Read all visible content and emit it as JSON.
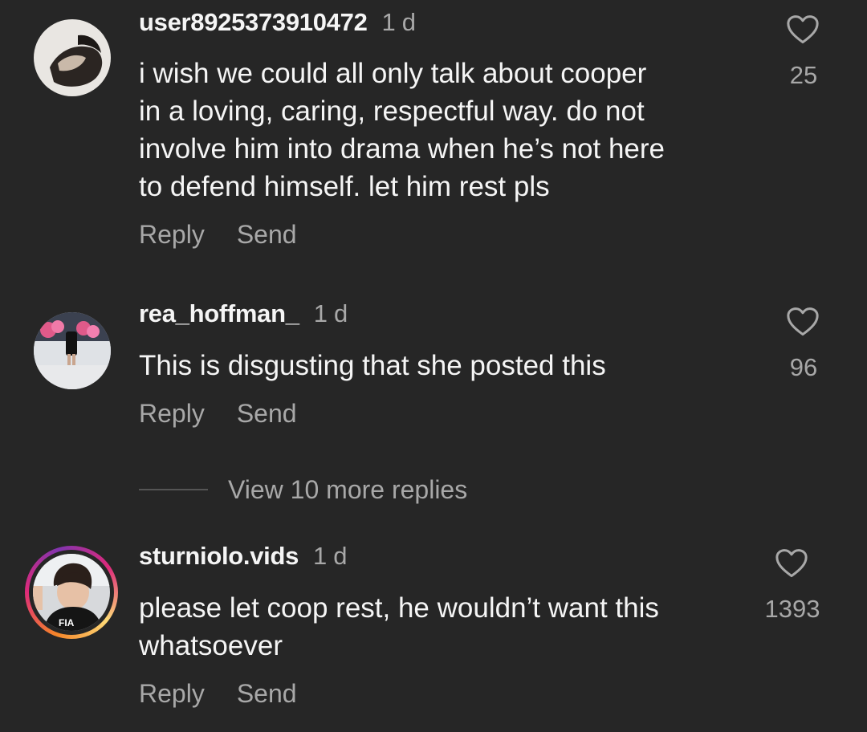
{
  "comments": [
    {
      "username": "user8925373910472",
      "time": "1 d",
      "text": "i wish we could all only talk about cooper\nin a loving, caring, respectful way. do not\ninvolve him into drama when he’s not here\nto defend himself. let him rest pls",
      "likes": "25",
      "reply_label": "Reply",
      "send_label": "Send",
      "icon": "heart-outline-icon"
    },
    {
      "username": "rea_hoffman_",
      "time": "1 d",
      "text": "This is disgusting that she posted this",
      "likes": "96",
      "reply_label": "Reply",
      "send_label": "Send",
      "icon": "heart-outline-icon"
    },
    {
      "username": "sturniolo.vids",
      "time": "1 d",
      "text": "please let coop rest, he wouldn’t want this\nwhatsoever",
      "likes": "1393",
      "reply_label": "Reply",
      "send_label": "Send",
      "icon": "heart-outline-icon",
      "has_story": true
    }
  ],
  "view_more": "View 10 more replies",
  "colors": {
    "background": "#262626",
    "primary_text": "#f5f5f5",
    "secondary_text": "#a8a8a8"
  }
}
